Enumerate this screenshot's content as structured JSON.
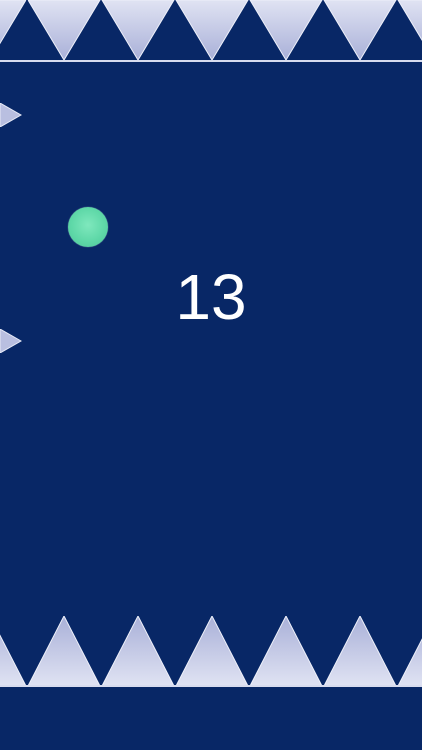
{
  "game": {
    "score": "13"
  },
  "colors": {
    "background": "#082766",
    "spike": "#c6cbe6",
    "ball": "#5fd8a8",
    "score_text": "#ffffff"
  }
}
